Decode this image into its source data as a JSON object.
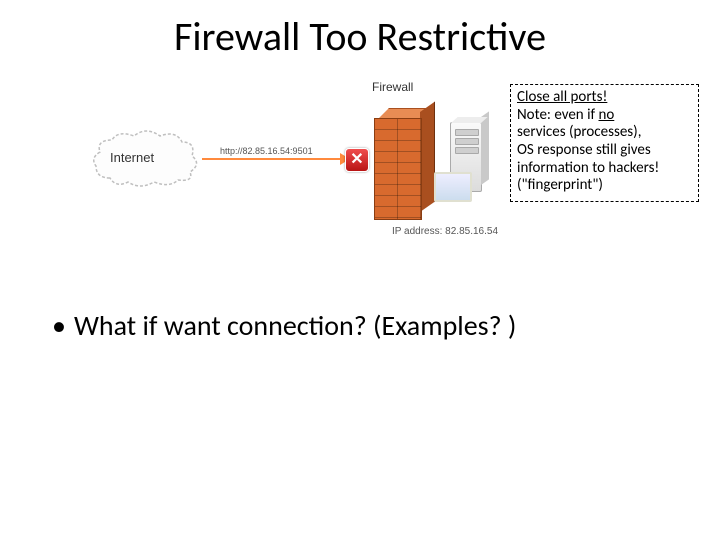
{
  "title": "Firewall Too Restrictive",
  "diagram": {
    "cloud_label": "Internet",
    "url_text": "http://82.85.16.54:9501",
    "firewall_label": "Firewall",
    "x_badge": "✕",
    "ip_text": "IP address: 82.85.16.54"
  },
  "note": {
    "line1": "Close all ports!",
    "line2_a": "Note: even if ",
    "line2_b": "no",
    "line3": "services (processes),",
    "line4": "OS response still gives",
    "line5": "information to hackers!",
    "line6": "(\"fingerprint\")"
  },
  "bullets": {
    "item1": "What if want connection?  (Examples? )"
  }
}
